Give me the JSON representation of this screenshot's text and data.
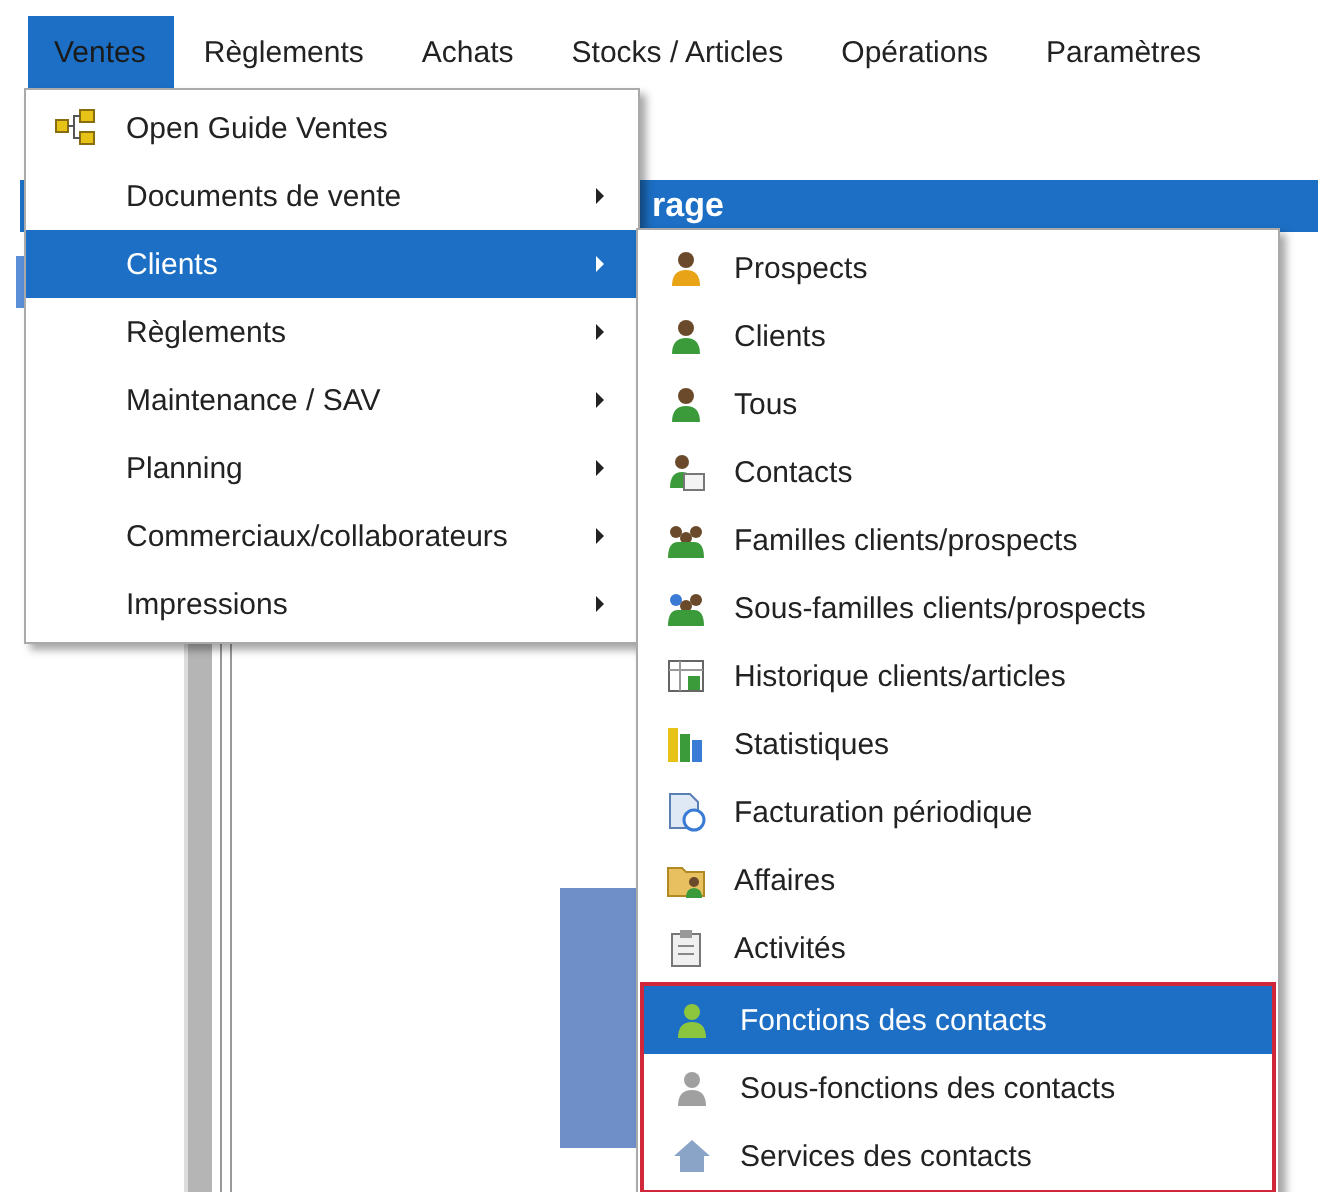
{
  "menu_bar": [
    {
      "label": "Ventes",
      "selected": true
    },
    {
      "label": "Règlements",
      "selected": false
    },
    {
      "label": "Achats",
      "selected": false
    },
    {
      "label": "Stocks / Articles",
      "selected": false
    },
    {
      "label": "Opérations",
      "selected": false
    },
    {
      "label": "Paramètres",
      "selected": false
    }
  ],
  "background_window": {
    "title": "rage"
  },
  "ventes_menu": [
    {
      "label": "Open Guide Ventes",
      "kind": "guide",
      "submenu": false,
      "selected": false
    },
    {
      "label": "Documents de vente",
      "kind": "plain",
      "submenu": true,
      "selected": false
    },
    {
      "label": "Clients",
      "kind": "plain",
      "submenu": true,
      "selected": true
    },
    {
      "label": "Règlements",
      "kind": "plain",
      "submenu": true,
      "selected": false
    },
    {
      "label": "Maintenance / SAV",
      "kind": "plain",
      "submenu": true,
      "selected": false
    },
    {
      "label": "Planning",
      "kind": "plain",
      "submenu": true,
      "selected": false
    },
    {
      "label": "Commerciaux/collaborateurs",
      "kind": "plain",
      "submenu": true,
      "selected": false
    },
    {
      "label": "Impressions",
      "kind": "plain",
      "submenu": true,
      "selected": false
    }
  ],
  "clients_submenu": [
    {
      "label": "Prospects",
      "kind": "prospect",
      "selected": false,
      "outlined": false
    },
    {
      "label": "Clients",
      "kind": "client",
      "selected": false,
      "outlined": false
    },
    {
      "label": "Tous",
      "kind": "client",
      "selected": false,
      "outlined": false
    },
    {
      "label": "Contacts",
      "kind": "contact",
      "selected": false,
      "outlined": false
    },
    {
      "label": "Familles clients/prospects",
      "kind": "family",
      "selected": false,
      "outlined": false
    },
    {
      "label": "Sous-familles clients/prospects",
      "kind": "subfamily",
      "selected": false,
      "outlined": false
    },
    {
      "label": "Historique clients/articles",
      "kind": "history",
      "selected": false,
      "outlined": false
    },
    {
      "label": "Statistiques",
      "kind": "stats",
      "selected": false,
      "outlined": false
    },
    {
      "label": "Facturation périodique",
      "kind": "billing",
      "selected": false,
      "outlined": false
    },
    {
      "label": "Affaires",
      "kind": "affair",
      "selected": false,
      "outlined": false
    },
    {
      "label": "Activités",
      "kind": "activity",
      "selected": false,
      "outlined": false
    },
    {
      "label": "Fonctions des contacts",
      "kind": "function",
      "selected": true,
      "outlined": true
    },
    {
      "label": "Sous-fonctions des contacts",
      "kind": "subfunction",
      "selected": false,
      "outlined": true
    },
    {
      "label": "Services des contacts",
      "kind": "service",
      "selected": false,
      "outlined": true
    }
  ]
}
